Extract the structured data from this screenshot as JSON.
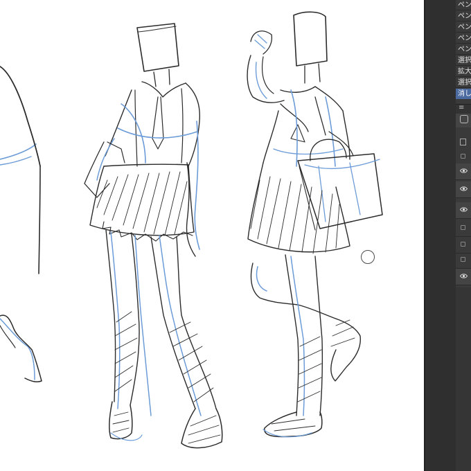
{
  "panel": {
    "menu_items": [
      "ペン(",
      "ペン(",
      "ペン(",
      "ペン(",
      "ペン(",
      "選択",
      "拡大",
      "選択",
      "消し"
    ],
    "selected_index": 8
  },
  "layers": [
    {
      "visible": false
    },
    {
      "visible": true
    },
    {
      "visible": true
    },
    {
      "visible": true
    },
    {
      "visible": false
    },
    {
      "visible": false
    },
    {
      "visible": false
    },
    {
      "visible": true
    }
  ],
  "colors": {
    "sketch_blue": "#6b9bd8",
    "line_dark": "#2b2b2b",
    "panel_bg": "#3a3a3a",
    "selection": "#4b6aa0"
  },
  "icons": [
    "brush-cursor-icon",
    "eye-icon",
    "layer-box-icon",
    "menu-icon",
    "layer-properties-icon"
  ]
}
